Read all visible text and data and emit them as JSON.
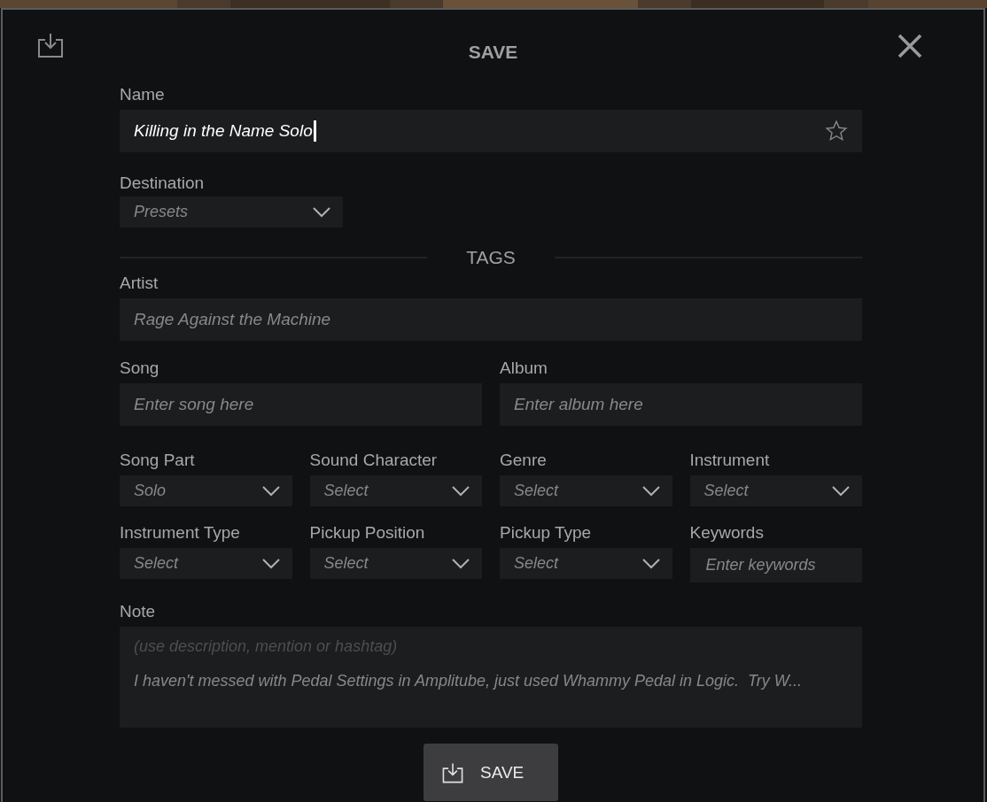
{
  "dialog": {
    "title": "SAVE"
  },
  "name": {
    "label": "Name",
    "value": "Killing in the Name Solo",
    "favorite": false
  },
  "destination": {
    "label": "Destination",
    "value": "Presets"
  },
  "tags_heading": "TAGS",
  "artist": {
    "label": "Artist",
    "placeholder": "Rage Against the Machine"
  },
  "song": {
    "label": "Song",
    "placeholder": "Enter song here"
  },
  "album": {
    "label": "Album",
    "placeholder": "Enter album here"
  },
  "tag_fields": [
    {
      "kind": "select",
      "label": "Song Part",
      "value": "Solo"
    },
    {
      "kind": "select",
      "label": "Sound Character",
      "value": "Select"
    },
    {
      "kind": "select",
      "label": "Genre",
      "value": "Select"
    },
    {
      "kind": "select",
      "label": "Instrument",
      "value": "Select"
    },
    {
      "kind": "select",
      "label": "Instrument Type",
      "value": "Select"
    },
    {
      "kind": "select",
      "label": "Pickup Position",
      "value": "Select"
    },
    {
      "kind": "select",
      "label": "Pickup Type",
      "value": "Select"
    },
    {
      "kind": "input",
      "label": "Keywords",
      "placeholder": "Enter keywords"
    }
  ],
  "note": {
    "label": "Note",
    "hint": "(use description, mention or hashtag)",
    "value": "I haven't messed with Pedal Settings in Amplitube, just used Whammy Pedal in Logic.  Try W..."
  },
  "save_button": "SAVE"
}
